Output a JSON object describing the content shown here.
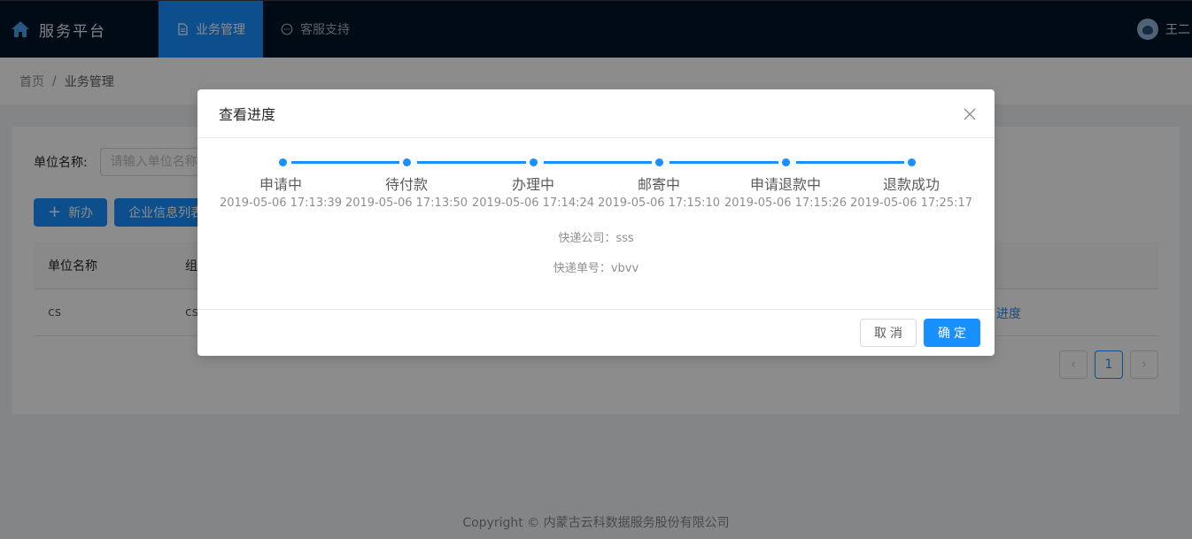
{
  "header": {
    "brand_title": "服务平台",
    "nav": [
      {
        "label": "业务管理",
        "icon": "file-icon",
        "active": true
      },
      {
        "label": "客服支持",
        "icon": "message-icon",
        "active": false
      }
    ],
    "user_name": "王二"
  },
  "breadcrumb": {
    "home": "首页",
    "separator": "/",
    "current": "业务管理"
  },
  "search": {
    "label": "单位名称:",
    "placeholder": "请输入单位名称"
  },
  "toolbar": {
    "new_label": "新办",
    "list_label": "企业信息列表"
  },
  "table": {
    "columns": [
      "单位名称",
      "组"
    ],
    "rows": [
      {
        "cells": [
          "cs",
          "cs"
        ],
        "action": "进度"
      }
    ]
  },
  "pagination": {
    "current": "1",
    "prev": "‹",
    "next": "›"
  },
  "footer": {
    "copyright": "Copyright © 内蒙古云科数据服务股份有限公司"
  },
  "modal": {
    "title": "查看进度",
    "steps": [
      {
        "label": "申请中",
        "time": "2019-05-06 17:13:39"
      },
      {
        "label": "待付款",
        "time": "2019-05-06 17:13:50"
      },
      {
        "label": "办理中",
        "time": "2019-05-06 17:14:24"
      },
      {
        "label": "邮寄中",
        "time": "2019-05-06 17:15:10"
      },
      {
        "label": "申请退款中",
        "time": "2019-05-06 17:15:26"
      },
      {
        "label": "退款成功",
        "time": "2019-05-06 17:25:17"
      }
    ],
    "courier_company": "快递公司：sss",
    "courier_number": "快递单号：vbvv",
    "cancel_label": "取消",
    "ok_label": "确定"
  },
  "colors": {
    "header_bg": "#001529",
    "accent": "#1890ff",
    "mask": "rgba(0,0,0,0.45)"
  }
}
